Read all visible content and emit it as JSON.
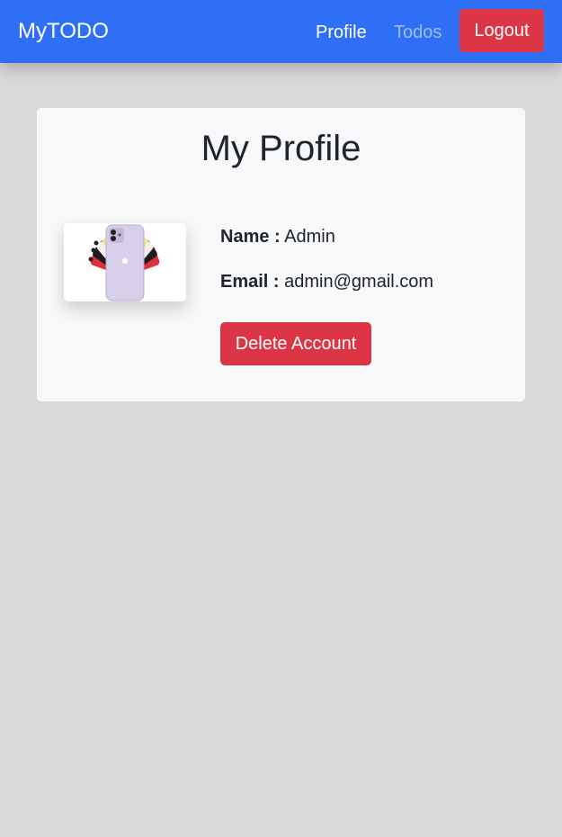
{
  "navbar": {
    "brand": "MyTODO",
    "links": [
      {
        "label": "Profile",
        "active": true
      },
      {
        "label": "Todos",
        "active": false
      }
    ],
    "logout_label": "Logout",
    "color": "#2f6ff6"
  },
  "profile": {
    "title": "My Profile",
    "avatar_icon": "phone-fan-image",
    "name_label": "Name :",
    "name_value": "Admin",
    "email_label": "Email :",
    "email_value": "admin@gmail.com",
    "delete_label": "Delete Account"
  },
  "colors": {
    "primary": "#2f6ff6",
    "danger": "#dc3545",
    "background": "#d9d9d9",
    "card": "#f7f8fa"
  }
}
